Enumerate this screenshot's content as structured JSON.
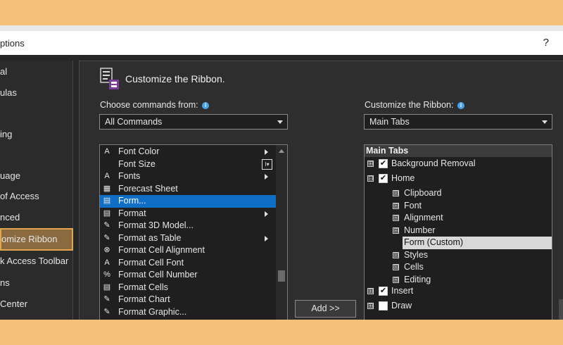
{
  "dialog": {
    "title_fragment": "ptions",
    "help_glyph": "?"
  },
  "sidebar": {
    "items": [
      {
        "label": "al"
      },
      {
        "label": "ulas"
      },
      {
        "label": "ing"
      },
      {
        "label": "uage"
      },
      {
        "label": "of Access"
      },
      {
        "label": "nced"
      },
      {
        "label": "omize Ribbon"
      },
      {
        "label": "k Access Toolbar"
      },
      {
        "label": "ns"
      },
      {
        "label": "Center"
      }
    ]
  },
  "main": {
    "heading": "Customize the Ribbon.",
    "choose_label": "Choose commands from:",
    "choose_value": "All Commands",
    "customize_label": "Customize the Ribbon:",
    "customize_value": "Main Tabs",
    "info_glyph": "i",
    "add_button": "Add >>"
  },
  "commands": [
    {
      "label": "Font Color",
      "icon": "font-color-icon",
      "glyph": "A"
    },
    {
      "label": "Font Size",
      "icon": "",
      "glyph": ""
    },
    {
      "label": "Fonts",
      "icon": "fonts-icon",
      "glyph": "A"
    },
    {
      "label": "Forecast Sheet",
      "icon": "forecast-sheet-icon",
      "glyph": "▦"
    },
    {
      "label": "Form...",
      "icon": "form-icon",
      "glyph": "▤"
    },
    {
      "label": "Format",
      "icon": "format-icon",
      "glyph": "▤"
    },
    {
      "label": "Format 3D Model...",
      "icon": "format-3d-model-icon",
      "glyph": "✎"
    },
    {
      "label": "Format as Table",
      "icon": "format-as-table-icon",
      "glyph": "✎"
    },
    {
      "label": "Format Cell Alignment",
      "icon": "format-cell-alignment-icon",
      "glyph": "⊗"
    },
    {
      "label": "Format Cell Font",
      "icon": "format-cell-font-icon",
      "glyph": "A"
    },
    {
      "label": "Format Cell Number",
      "icon": "format-cell-number-icon",
      "glyph": "%"
    },
    {
      "label": "Format Cells",
      "icon": "format-cells-icon",
      "glyph": "▤"
    },
    {
      "label": "Format Chart",
      "icon": "format-chart-icon",
      "glyph": "✎"
    },
    {
      "label": "Format Graphic...",
      "icon": "format-graphic-icon",
      "glyph": "✎"
    }
  ],
  "font_size_box": "I▾",
  "tree": {
    "header": "Main Tabs",
    "nodes": [
      {
        "label": "Background Removal",
        "level": 0,
        "expander": "⊞",
        "checked": true
      },
      {
        "label": "Home",
        "level": 0,
        "expander": "⊟",
        "checked": true
      },
      {
        "label": "Clipboard",
        "level": 1,
        "expander": "⊞"
      },
      {
        "label": "Font",
        "level": 1,
        "expander": "⊞"
      },
      {
        "label": "Alignment",
        "level": 1,
        "expander": "⊞"
      },
      {
        "label": "Number",
        "level": 1,
        "expander": "⊞"
      },
      {
        "label": "Form (Custom)",
        "level": 1,
        "expander": ""
      },
      {
        "label": "Styles",
        "level": 1,
        "expander": "⊞"
      },
      {
        "label": "Cells",
        "level": 1,
        "expander": "⊞"
      },
      {
        "label": "Editing",
        "level": 1,
        "expander": "⊞"
      },
      {
        "label": "Insert",
        "level": 0,
        "expander": "⊞",
        "checked": true
      },
      {
        "label": "Draw",
        "level": 0,
        "expander": "⊞",
        "checked": false
      }
    ]
  },
  "colors": {
    "accent_selected": "#0f6fc6",
    "sidebar_active": "#8a6a3e",
    "backdrop": "#f5c07a"
  }
}
